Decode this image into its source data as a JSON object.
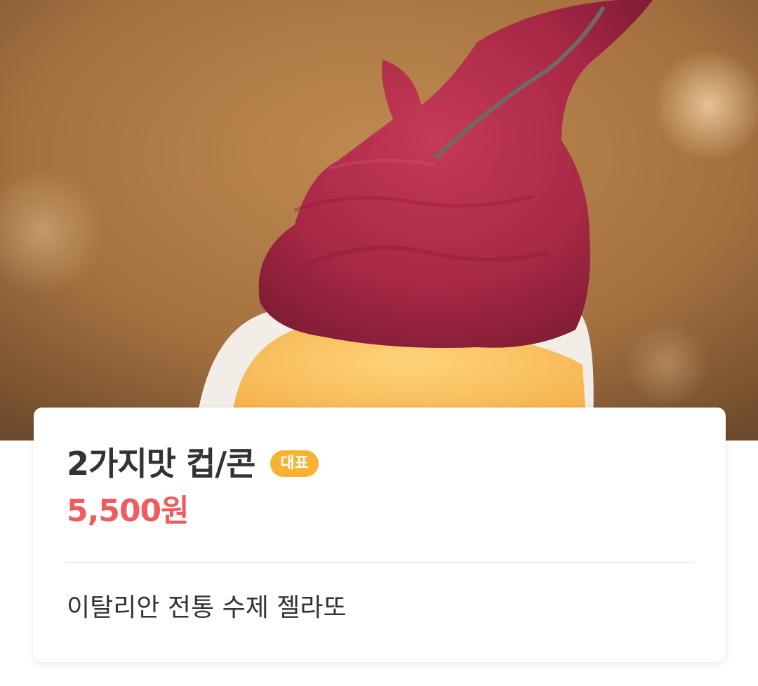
{
  "hero": {
    "image": "gelato-photo"
  },
  "product": {
    "name": "2가지맛 컵/콘",
    "badge": "대표",
    "price": "5,500원",
    "description": "이탈리안 전통 수제 젤라또"
  },
  "colors": {
    "price": "#ef5b5f",
    "badge": "#f7b232",
    "title": "#333333"
  }
}
